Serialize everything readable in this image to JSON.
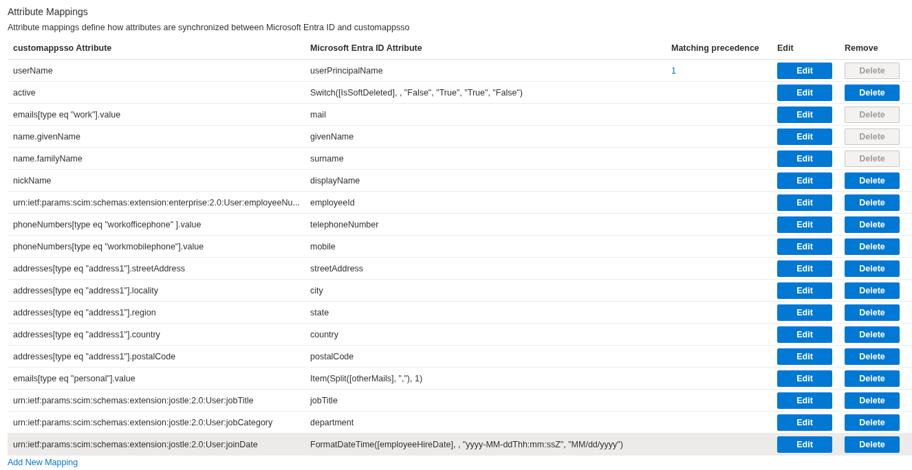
{
  "section": {
    "title": "Attribute Mappings",
    "description": "Attribute mappings define how attributes are synchronized between Microsoft Entra ID and customappsso"
  },
  "table": {
    "columns": [
      "customappsso Attribute",
      "Microsoft Entra ID Attribute",
      "Matching precedence",
      "Edit",
      "Remove"
    ],
    "rows": [
      {
        "target": "userName",
        "source": "userPrincipalName",
        "precedence": "1",
        "edit": "Edit",
        "delete": "Delete",
        "delete_disabled": true,
        "highlighted": false
      },
      {
        "target": "active",
        "source": "Switch([IsSoftDeleted], , \"False\", \"True\", \"True\", \"False\")",
        "edit": "Edit",
        "delete": "Delete",
        "delete_disabled": false,
        "highlighted": false
      },
      {
        "target": "emails[type eq \"work\"].value",
        "source": "mail",
        "edit": "Edit",
        "delete": "Delete",
        "delete_disabled": true,
        "highlighted": false
      },
      {
        "target": "name.givenName",
        "source": "givenName",
        "edit": "Edit",
        "delete": "Delete",
        "delete_disabled": true,
        "highlighted": false
      },
      {
        "target": "name.familyName",
        "source": "surname",
        "edit": "Edit",
        "delete": "Delete",
        "delete_disabled": true,
        "highlighted": false
      },
      {
        "target": "nickName",
        "source": "displayName",
        "edit": "Edit",
        "delete": "Delete",
        "delete_disabled": false,
        "highlighted": false
      },
      {
        "target": "urn:ietf:params:scim:schemas:extension:enterprise:2.0:User:employeeNu...",
        "source": "employeeId",
        "edit": "Edit",
        "delete": "Delete",
        "delete_disabled": false,
        "highlighted": false
      },
      {
        "target": "phoneNumbers[type eq \"workofficephone\" ].value",
        "source": "telephoneNumber",
        "edit": "Edit",
        "delete": "Delete",
        "delete_disabled": false,
        "highlighted": false
      },
      {
        "target": "phoneNumbers[type eq \"workmobilephone\"].value",
        "source": "mobile",
        "edit": "Edit",
        "delete": "Delete",
        "delete_disabled": false,
        "highlighted": false
      },
      {
        "target": "addresses[type eq \"address1\"].streetAddress",
        "source": "streetAddress",
        "edit": "Edit",
        "delete": "Delete",
        "delete_disabled": false,
        "highlighted": false
      },
      {
        "target": "addresses[type eq \"address1\"].locality",
        "source": "city",
        "edit": "Edit",
        "delete": "Delete",
        "delete_disabled": false,
        "highlighted": false
      },
      {
        "target": "addresses[type eq \"address1\"].region",
        "source": "state",
        "edit": "Edit",
        "delete": "Delete",
        "delete_disabled": false,
        "highlighted": false
      },
      {
        "target": "addresses[type eq \"address1\"].country",
        "source": "country",
        "edit": "Edit",
        "delete": "Delete",
        "delete_disabled": false,
        "highlighted": false
      },
      {
        "target": "addresses[type eq \"address1\"].postalCode",
        "source": "postalCode",
        "edit": "Edit",
        "delete": "Delete",
        "delete_disabled": false,
        "highlighted": false
      },
      {
        "target": "emails[type eq \"personal\"].value",
        "source": "Item(Split([otherMails], \",\"), 1)",
        "edit": "Edit",
        "delete": "Delete",
        "delete_disabled": false,
        "highlighted": false
      },
      {
        "target": "urn:ietf:params:scim:schemas:extension:jostle:2.0:User:jobTitle",
        "source": "jobTitle",
        "edit": "Edit",
        "delete": "Delete",
        "delete_disabled": false,
        "highlighted": false
      },
      {
        "target": "urn:ietf:params:scim:schemas:extension:jostle:2.0:User:jobCategory",
        "source": "department",
        "edit": "Edit",
        "delete": "Delete",
        "delete_disabled": false,
        "highlighted": false
      },
      {
        "target": "urn:ietf:params:scim:schemas:extension:jostle:2.0:User:joinDate",
        "source": "FormatDateTime([employeeHireDate], , \"yyyy-MM-ddThh:mm:ssZ\", \"MM/dd/yyyy\")",
        "edit": "Edit",
        "delete": "Delete",
        "delete_disabled": false,
        "highlighted": true
      }
    ]
  },
  "add_link": "Add New Mapping"
}
